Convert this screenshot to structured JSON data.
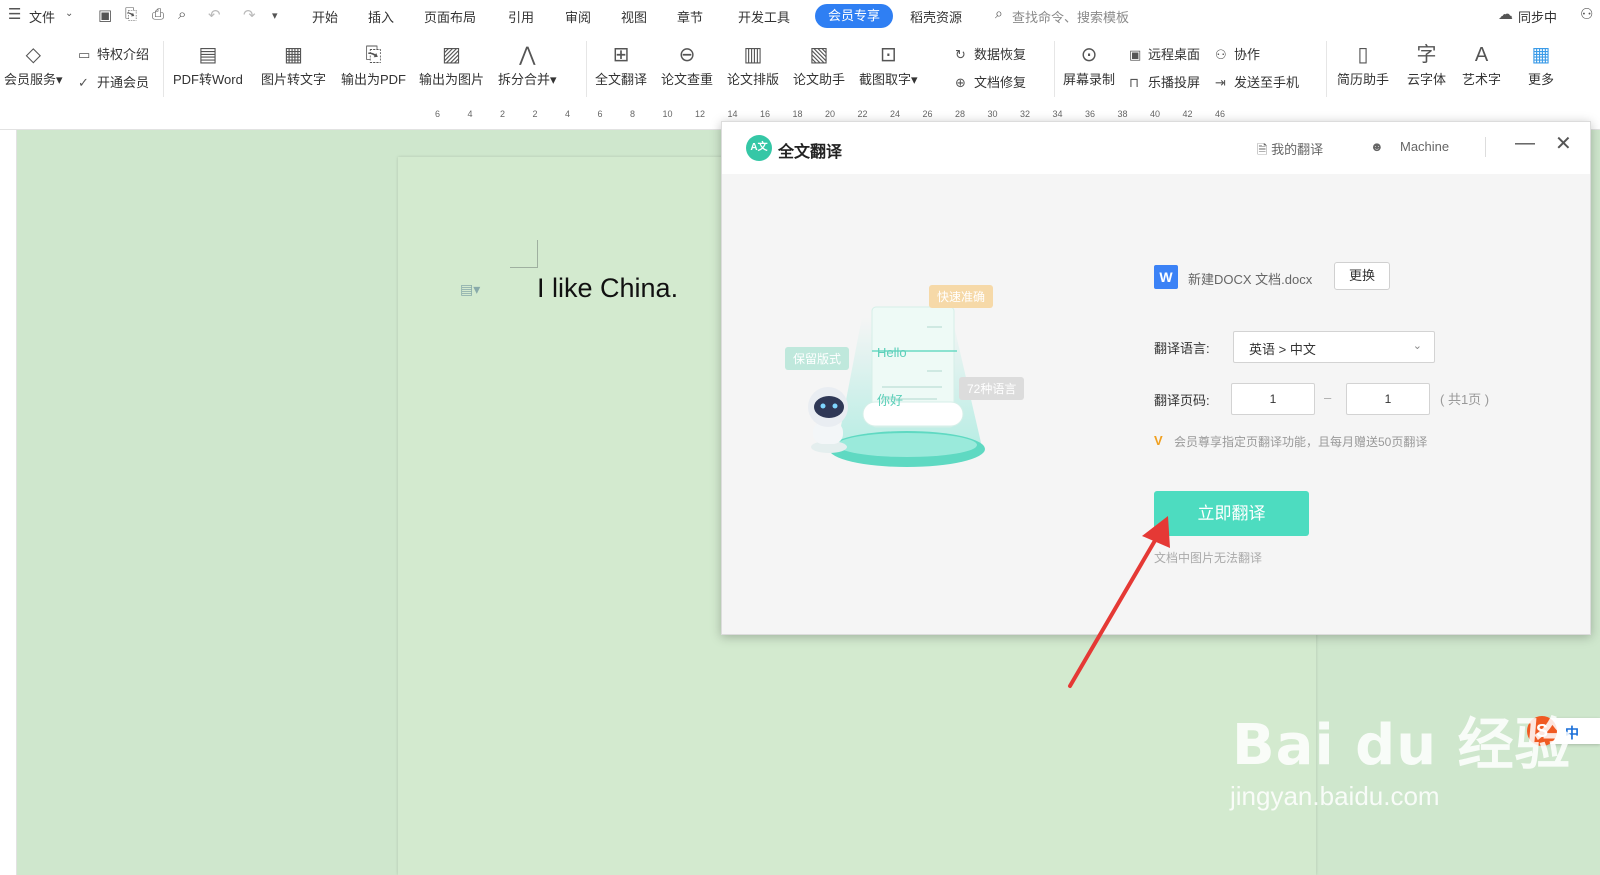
{
  "menubar": {
    "file": "文件",
    "tabs": [
      "开始",
      "插入",
      "页面布局",
      "引用",
      "审阅",
      "视图",
      "章节",
      "开发工具",
      "会员专享",
      "稻壳资源"
    ],
    "search_placeholder": "查找命令、搜索模板",
    "sync": "同步中"
  },
  "ribbon": {
    "member_service": "会员服务",
    "privilege_intro": "特权介绍",
    "open_member": "开通会员",
    "tools": [
      "PDF转Word",
      "图片转文字",
      "输出为PDF",
      "输出为图片",
      "拆分合并",
      "全文翻译",
      "论文查重",
      "论文排版",
      "论文助手",
      "截图取字"
    ],
    "data_recovery": "数据恢复",
    "doc_repair": "文档修复",
    "screen_record": "屏幕录制",
    "remote_desktop": "远程桌面",
    "cast": "乐播投屏",
    "collab": "协作",
    "send_phone": "发送至手机",
    "tools2": [
      "简历助手",
      "云字体",
      "艺术字",
      "更多"
    ]
  },
  "ruler_ticks": [
    "6",
    "4",
    "2",
    "2",
    "4",
    "6",
    "8",
    "10",
    "12",
    "14",
    "16",
    "18",
    "20",
    "22",
    "24",
    "26",
    "28",
    "30",
    "32",
    "34",
    "36",
    "38",
    "40",
    "42",
    "46"
  ],
  "document": {
    "text": "I like China."
  },
  "dialog": {
    "title": "全文翻译",
    "logo_text": "A文",
    "my_translations": "我的翻译",
    "user": "Machine",
    "file_name": "新建DOCX 文档.docx",
    "change": "更换",
    "lang_label": "翻译语言:",
    "lang_value": "英语 > 中文",
    "page_label": "翻译页码:",
    "page_from": "1",
    "page_to": "1",
    "page_total": "( 共1页 )",
    "vip_note": "会员尊享指定页翻译功能，且每月赠送50页翻译",
    "translate_button": "立即翻译",
    "image_note": "文档中图片无法翻译",
    "illustration": {
      "tag_fast": "快速准确",
      "tag_format": "保留版式",
      "tag_langs": "72种语言",
      "hello": "Hello",
      "nihao": "你好"
    }
  },
  "ime": {
    "label": "中"
  },
  "watermark": {
    "main": "Bai du 经验",
    "sub": "jingyan.baidu.com"
  },
  "colors": {
    "accent": "#2f7ff3",
    "translate_btn": "#4ddcc0",
    "doc_bg": "#cfe7cd",
    "arrow": "#e53935"
  }
}
